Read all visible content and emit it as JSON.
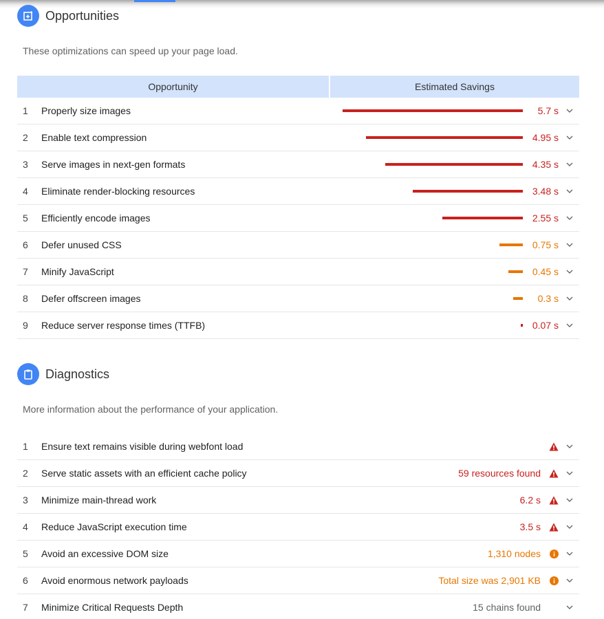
{
  "colors": {
    "accent": "#4285f4",
    "header_bg": "#d3e3fc",
    "fail": "#c7221f",
    "average": "#e67700",
    "neutral": "#616161"
  },
  "opportunities": {
    "icon": "opportunity-icon",
    "title": "Opportunities",
    "description": "These optimizations can speed up your page load.",
    "columns": [
      "Opportunity",
      "Estimated Savings"
    ],
    "max_savings_s": 5.7,
    "items": [
      {
        "index": "1",
        "label": "Properly size images",
        "savings_s": 5.7,
        "value": "5.7 s",
        "severity": "fail"
      },
      {
        "index": "2",
        "label": "Enable text compression",
        "savings_s": 4.95,
        "value": "4.95 s",
        "severity": "fail"
      },
      {
        "index": "3",
        "label": "Serve images in next-gen formats",
        "savings_s": 4.35,
        "value": "4.35 s",
        "severity": "fail"
      },
      {
        "index": "4",
        "label": "Eliminate render-blocking resources",
        "savings_s": 3.48,
        "value": "3.48 s",
        "severity": "fail"
      },
      {
        "index": "5",
        "label": "Efficiently encode images",
        "savings_s": 2.55,
        "value": "2.55 s",
        "severity": "fail"
      },
      {
        "index": "6",
        "label": "Defer unused CSS",
        "savings_s": 0.75,
        "value": "0.75 s",
        "severity": "average"
      },
      {
        "index": "7",
        "label": "Minify JavaScript",
        "savings_s": 0.45,
        "value": "0.45 s",
        "severity": "average"
      },
      {
        "index": "8",
        "label": "Defer offscreen images",
        "savings_s": 0.3,
        "value": "0.3 s",
        "severity": "average"
      },
      {
        "index": "9",
        "label": "Reduce server response times (TTFB)",
        "savings_s": 0.07,
        "value": "0.07 s",
        "severity": "fail"
      }
    ]
  },
  "diagnostics": {
    "icon": "clipboard-icon",
    "title": "Diagnostics",
    "description": "More information about the performance of your application.",
    "items": [
      {
        "index": "1",
        "label": "Ensure text remains visible during webfont load",
        "value": "",
        "severity": "fail",
        "status_icon": "warning-triangle-icon"
      },
      {
        "index": "2",
        "label": "Serve static assets with an efficient cache policy",
        "value": "59 resources found",
        "severity": "fail",
        "status_icon": "warning-triangle-icon"
      },
      {
        "index": "3",
        "label": "Minimize main-thread work",
        "value": "6.2 s",
        "severity": "fail",
        "status_icon": "warning-triangle-icon"
      },
      {
        "index": "4",
        "label": "Reduce JavaScript execution time",
        "value": "3.5 s",
        "severity": "fail",
        "status_icon": "warning-triangle-icon"
      },
      {
        "index": "5",
        "label": "Avoid an excessive DOM size",
        "value": "1,310 nodes",
        "severity": "average",
        "status_icon": "info-circle-icon"
      },
      {
        "index": "6",
        "label": "Avoid enormous network payloads",
        "value": "Total size was 2,901 KB",
        "severity": "average",
        "status_icon": "info-circle-icon"
      },
      {
        "index": "7",
        "label": "Minimize Critical Requests Depth",
        "value": "15 chains found",
        "severity": "neutral",
        "status_icon": ""
      }
    ]
  }
}
